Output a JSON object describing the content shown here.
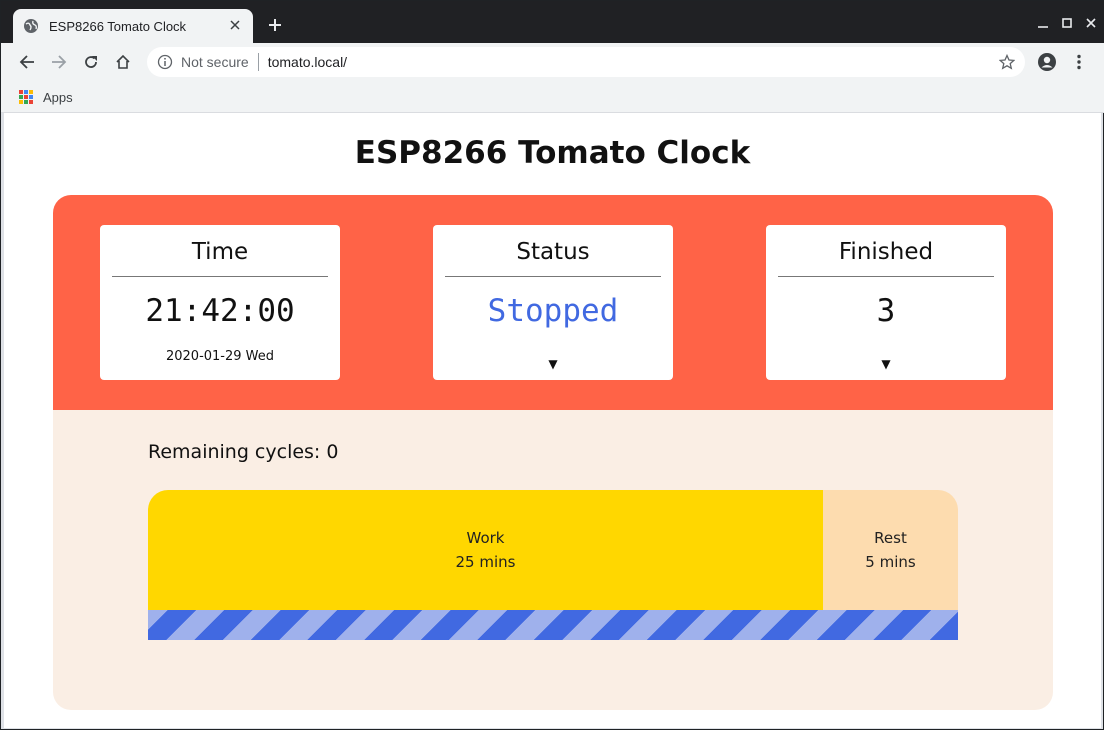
{
  "browser": {
    "tab_title": "ESP8266 Tomato Clock",
    "security_label": "Not secure",
    "url": "tomato.local/",
    "bookmarks": [
      {
        "label": "Apps"
      }
    ]
  },
  "page": {
    "heading": "ESP8266 Tomato Clock",
    "cards": {
      "time": {
        "title": "Time",
        "value": "21:42:00",
        "date": "2020-01-29 Wed"
      },
      "status": {
        "title": "Status",
        "value": "Stopped",
        "arrow": "▼"
      },
      "finished": {
        "title": "Finished",
        "value": "3",
        "arrow": "▼"
      }
    },
    "remaining_cycles": "Remaining cycles: 0",
    "segments": {
      "work": {
        "name": "Work",
        "duration": "25 mins"
      },
      "rest": {
        "name": "Rest",
        "duration": "5 mins"
      }
    },
    "colors": {
      "accent": "#ff6347",
      "status_text": "#4169e1",
      "work": "#ffd700",
      "rest": "#fddcaf",
      "background": "#faeee4"
    },
    "icons": [
      "globe-icon",
      "close-icon",
      "plus-icon",
      "minimize-icon",
      "maximize-icon",
      "back-icon",
      "forward-icon",
      "reload-icon",
      "home-icon",
      "info-icon",
      "star-icon",
      "account-icon",
      "menu-icon",
      "apps-icon"
    ]
  }
}
